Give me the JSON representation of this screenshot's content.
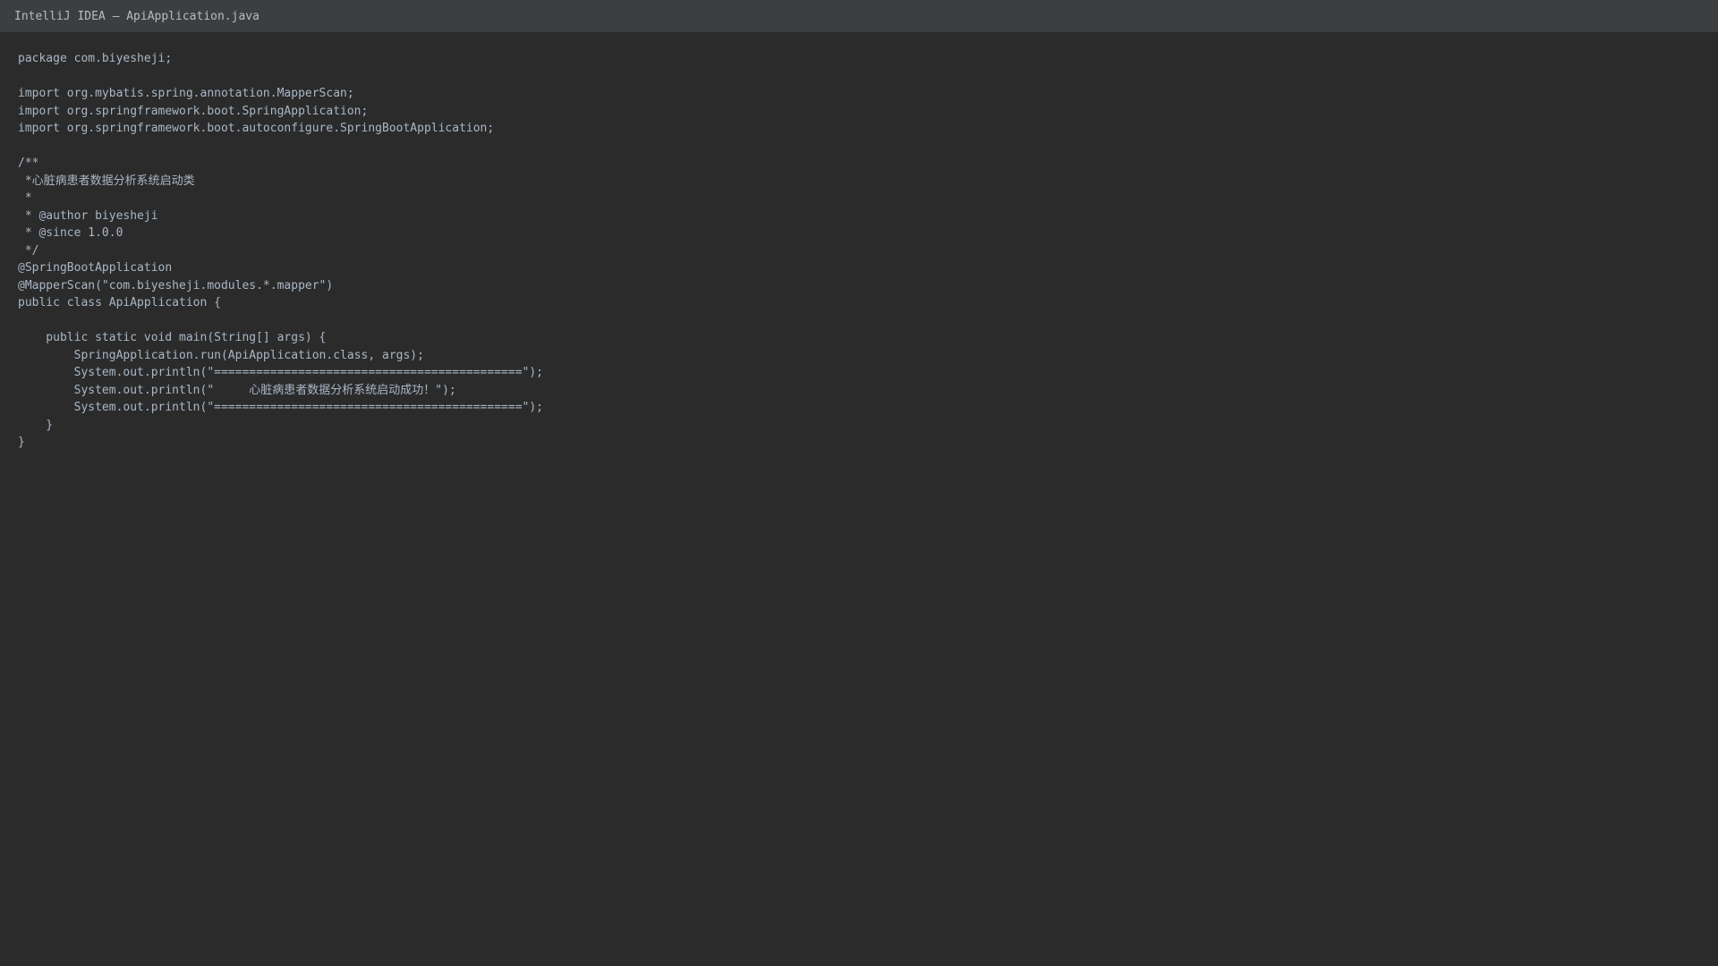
{
  "window": {
    "title": "IntelliJ IDEA — ApiApplication.java"
  },
  "editor": {
    "lines": [
      "package com.biyesheji;",
      "",
      "import org.mybatis.spring.annotation.MapperScan;",
      "import org.springframework.boot.SpringApplication;",
      "import org.springframework.boot.autoconfigure.SpringBootApplication;",
      "",
      "/**",
      " *心脏病患者数据分析系统启动类",
      " *",
      " * @author biyesheji",
      " * @since 1.0.0",
      " */",
      "@SpringBootApplication",
      "@MapperScan(\"com.biyesheji.modules.*.mapper\")",
      "public class ApiApplication {",
      "",
      "    public static void main(String[] args) {",
      "        SpringApplication.run(ApiApplication.class, args);",
      "        System.out.println(\"============================================\");",
      "        System.out.println(\"     心脏病患者数据分析系统启动成功！\");",
      "        System.out.println(\"============================================\");",
      "    }",
      "}"
    ]
  },
  "colors": {
    "background": "#2b2b2b",
    "titlebar": "#3c3f41",
    "text": "#a9b7c6"
  }
}
